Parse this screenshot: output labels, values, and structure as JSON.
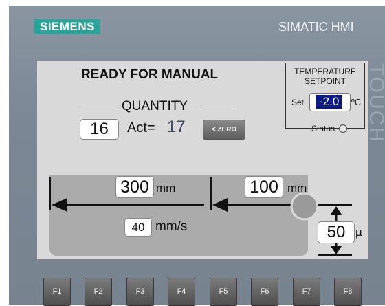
{
  "header": {
    "brand_logo": "SIEMENS",
    "product_name": "SIMATIC HMI",
    "side_label": "TOUCH"
  },
  "screen": {
    "title": "READY FOR MANUAL",
    "quantity_label": "QUANTITY",
    "quantity_set": "16",
    "actual_label": "Act=",
    "actual_value": "17",
    "zero_button": "< ZERO"
  },
  "temperature": {
    "title_line1": "TEMPERATURE",
    "title_line2": "SETPOINT",
    "set_label": "Set",
    "set_value": "-2.0",
    "unit": "ºC",
    "status_label": "Status"
  },
  "machine": {
    "length_value": "300",
    "length_unit": "mm",
    "offset_value": "100",
    "offset_unit": "mm",
    "speed_value": "40",
    "speed_unit": "mm/s",
    "thickness_value": "50",
    "thickness_unit": "µ"
  },
  "function_keys": [
    "F1",
    "F2",
    "F3",
    "F4",
    "F5",
    "F6",
    "F7",
    "F8"
  ],
  "colors": {
    "brand": "#2aa39a",
    "bezel": "#7b8794",
    "screen": "#d9d9d9",
    "selected": "#0a1a8a"
  }
}
